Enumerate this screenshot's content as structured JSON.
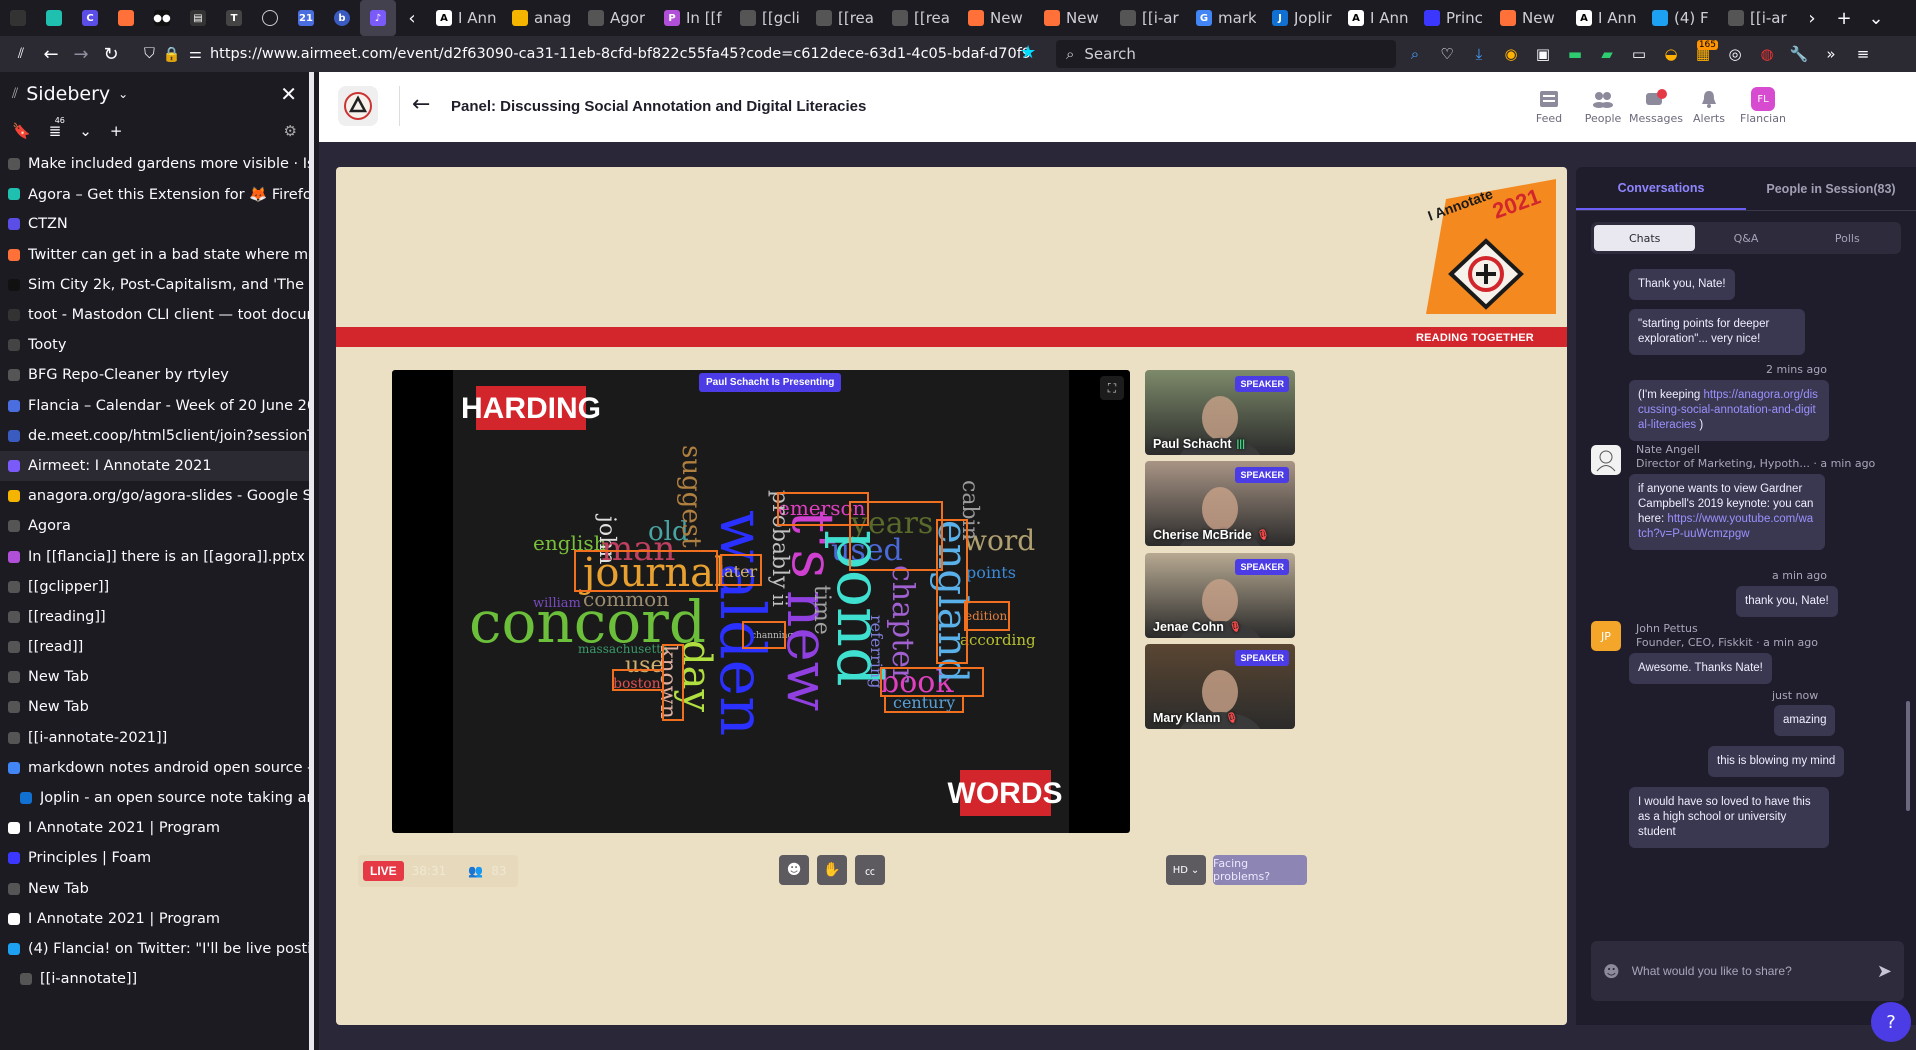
{
  "browser": {
    "tabs": [
      {
        "label": "I Ann",
        "favicon": "A",
        "color": "#ffffff"
      },
      {
        "label": "anag",
        "favicon": "",
        "color": "#f4b400"
      },
      {
        "label": "Agor",
        "favicon": "",
        "color": "#555555"
      },
      {
        "label": "In [[f",
        "favicon": "P",
        "color": "#b14fd8"
      },
      {
        "label": "[[gcli",
        "favicon": "",
        "color": "#555555"
      },
      {
        "label": "[[rea",
        "favicon": "",
        "color": "#555555"
      },
      {
        "label": "[[rea",
        "favicon": "",
        "color": "#555555"
      },
      {
        "label": "New",
        "favicon": "",
        "color": "#ff7139"
      },
      {
        "label": "New",
        "favicon": "",
        "color": "#ff7139"
      },
      {
        "label": "[[i-ar",
        "favicon": "",
        "color": "#555555"
      },
      {
        "label": "mark",
        "favicon": "G",
        "color": "#4285f4"
      },
      {
        "label": "Joplir",
        "favicon": "J",
        "color": "#1071d3"
      },
      {
        "label": "I Ann",
        "favicon": "A",
        "color": "#ffffff"
      },
      {
        "label": "Princ",
        "favicon": "",
        "color": "#3b37ff"
      },
      {
        "label": "New",
        "favicon": "",
        "color": "#ff7139"
      },
      {
        "label": "I Ann",
        "favicon": "A",
        "color": "#ffffff"
      },
      {
        "label": "(4) F",
        "favicon": "",
        "color": "#1da1f2"
      },
      {
        "label": "[[i-ar",
        "favicon": "",
        "color": "#555555"
      }
    ],
    "url": "https://www.airmeet.com/event/d2f63090-ca31-11eb-8cfd-bf822c55fa45?code=c612dece-63d1-4c05-bdaf-d70f9",
    "search_placeholder": "Search",
    "badge_count": "165"
  },
  "sidebar": {
    "title": "Sidebery",
    "count": "46",
    "items": [
      {
        "label": "Make included gardens more visible · Issue",
        "icon_color": "#555555",
        "child": false,
        "active": false
      },
      {
        "label": "Agora – Get this Extension for 🦊 Firefox (en",
        "icon_color": "#20c0b0",
        "child": false,
        "active": false
      },
      {
        "label": "CTZN",
        "icon_color": "#5b4ee6",
        "child": false,
        "active": false
      },
      {
        "label": "Twitter can get in a bad state where moa c",
        "icon_color": "#ff7139",
        "child": false,
        "active": false
      },
      {
        "label": "Sim City 2k, Post-Capitalism, and 'The Four",
        "icon_color": "#111111",
        "child": false,
        "active": false
      },
      {
        "label": "toot - Mastodon CLI client — toot documen",
        "icon_color": "#333333",
        "child": false,
        "active": false
      },
      {
        "label": "Tooty",
        "icon_color": "#444444",
        "child": false,
        "active": false
      },
      {
        "label": "BFG Repo-Cleaner by rtyley",
        "icon_color": "#555555",
        "child": false,
        "active": false
      },
      {
        "label": "Flancia – Calendar - Week of 20 June 2021",
        "icon_color": "#4a6ee0",
        "child": false,
        "active": false
      },
      {
        "label": "de.meet.coop/html5client/join?sessionToke",
        "icon_color": "#3a5bbf",
        "child": false,
        "active": false
      },
      {
        "label": "Airmeet: I Annotate 2021",
        "icon_color": "#7a5af8",
        "child": false,
        "active": true
      },
      {
        "label": "anagora.org/go/agora-slides - Google Slide",
        "icon_color": "#f4b400",
        "child": false,
        "active": false
      },
      {
        "label": "Agora",
        "icon_color": "#555555",
        "child": false,
        "active": false
      },
      {
        "label": "In [[flancia]] there is an [[agora]].pptx",
        "icon_color": "#b14fd8",
        "child": false,
        "active": false
      },
      {
        "label": "[[gclipper]]",
        "icon_color": "#555555",
        "child": false,
        "active": false
      },
      {
        "label": "[[reading]]",
        "icon_color": "#555555",
        "child": false,
        "active": false
      },
      {
        "label": "[[read]]",
        "icon_color": "#555555",
        "child": false,
        "active": false
      },
      {
        "label": "New Tab",
        "icon_color": "#555555",
        "child": false,
        "active": false
      },
      {
        "label": "New Tab",
        "icon_color": "#555555",
        "child": false,
        "active": false
      },
      {
        "label": "[[i-annotate-2021]]",
        "icon_color": "#555555",
        "child": false,
        "active": false
      },
      {
        "label": "markdown notes android open source - Goo",
        "icon_color": "#4285f4",
        "child": false,
        "active": false
      },
      {
        "label": "Joplin - an open source note taking and to",
        "icon_color": "#1071d3",
        "child": true,
        "active": false
      },
      {
        "label": "I Annotate 2021 | Program",
        "icon_color": "#ffffff",
        "child": false,
        "active": false
      },
      {
        "label": "Principles | Foam",
        "icon_color": "#3b37ff",
        "child": false,
        "active": false
      },
      {
        "label": "New Tab",
        "icon_color": "#555555",
        "child": false,
        "active": false
      },
      {
        "label": "I Annotate 2021 | Program",
        "icon_color": "#ffffff",
        "child": false,
        "active": false
      },
      {
        "label": "(4) Flancia! on Twitter: \"I'll be live posting s",
        "icon_color": "#1da1f2",
        "child": false,
        "active": false
      },
      {
        "label": "[[i-annotate]]",
        "icon_color": "#555555",
        "child": true,
        "active": false
      }
    ]
  },
  "app": {
    "session_title": "Panel: Discussing Social Annotation and Digital Literacies",
    "nav": [
      {
        "label": "Feed",
        "icon": "feed-icon"
      },
      {
        "label": "People",
        "icon": "people-icon"
      },
      {
        "label": "Messages",
        "icon": "messages-icon"
      },
      {
        "label": "Alerts",
        "icon": "bell-icon"
      },
      {
        "label": "Flancian",
        "icon": "avatar",
        "initials": "FL"
      }
    ],
    "brand": {
      "badge_title": "I Annotate",
      "badge_year": "2021",
      "tagline": "READING TOGETHER"
    },
    "presenting": "Paul Schacht Is Presenting",
    "slide_words": {
      "top": "HARDING",
      "bottom": "WORDS"
    },
    "speakers": [
      {
        "name": "Paul Schacht",
        "badge": "SPEAKER",
        "bg": "#7d8a6a",
        "mic": "on"
      },
      {
        "name": "Cherise McBride",
        "badge": "SPEAKER",
        "bg": "#a89485",
        "mic": "off"
      },
      {
        "name": "Jenae Cohn",
        "badge": "SPEAKER",
        "bg": "#b7a992",
        "mic": "off"
      },
      {
        "name": "Mary Klann",
        "badge": "SPEAKER",
        "bg": "#5a4632",
        "mic": "off"
      }
    ],
    "bottom": {
      "live": "LIVE",
      "timer": "38:31",
      "attendees": "83",
      "hd": "HD",
      "facing": "Facing problems?"
    }
  },
  "panel": {
    "tabs": [
      {
        "label": "Conversations",
        "active": true
      },
      {
        "label": "People in Session(83)",
        "active": false
      }
    ],
    "subtabs": [
      {
        "label": "Chats",
        "active": true
      },
      {
        "label": "Q&A",
        "active": false
      },
      {
        "label": "Polls",
        "active": false
      }
    ],
    "messages": {
      "m1": "Thank you, Nate!",
      "m2": "\"starting points for deeper exploration\"... very nice!",
      "ts1": "2 mins ago",
      "m3_pre": "(I'm keeping ",
      "m3_link": "https://anagora.org/discussing-social-annotation-and-digital-literacies",
      "m3_post": " )",
      "nate_name": "Nate Angell",
      "nate_title": "Director of Marketing, Hypoth... · a min ago",
      "m4_pre": "if anyone wants to view Gardner Campbell's 2019 keynote: you can here: ",
      "m4_link": "https://www.youtube.com/watch?v=P-uuWcmzpgw",
      "ts2": "a min ago",
      "m5": "thank you, Nate!",
      "john_name": "John Pettus",
      "john_title": "Founder, CEO, Fiskkit · a min ago",
      "john_initials": "JP",
      "m6": "Awesome. Thanks Nate!",
      "ts3": "just now",
      "m7": "amazing",
      "m8": "this is blowing my mind",
      "m9": "I would have so loved to have this as a high school or university student"
    },
    "compose_placeholder": "What would you like to share?"
  }
}
